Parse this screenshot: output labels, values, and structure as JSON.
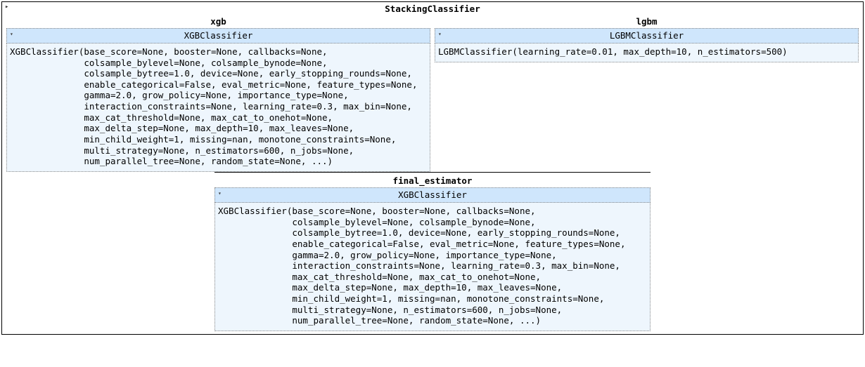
{
  "main": {
    "title": "StackingClassifier",
    "toggle_glyph": "▸"
  },
  "estimators": [
    {
      "name": "xgb",
      "header": "XGBClassifier",
      "toggle_glyph": "▾",
      "body": "XGBClassifier(base_score=None, booster=None, callbacks=None,\n              colsample_bylevel=None, colsample_bynode=None,\n              colsample_bytree=1.0, device=None, early_stopping_rounds=None,\n              enable_categorical=False, eval_metric=None, feature_types=None,\n              gamma=2.0, grow_policy=None, importance_type=None,\n              interaction_constraints=None, learning_rate=0.3, max_bin=None,\n              max_cat_threshold=None, max_cat_to_onehot=None,\n              max_delta_step=None, max_depth=10, max_leaves=None,\n              min_child_weight=1, missing=nan, monotone_constraints=None,\n              multi_strategy=None, n_estimators=600, n_jobs=None,\n              num_parallel_tree=None, random_state=None, ...)"
    },
    {
      "name": "lgbm",
      "header": "LGBMClassifier",
      "toggle_glyph": "▾",
      "body": "LGBMClassifier(learning_rate=0.01, max_depth=10, n_estimators=500)"
    }
  ],
  "final_estimator": {
    "title": "final_estimator",
    "header": "XGBClassifier",
    "toggle_glyph": "▾",
    "body": "XGBClassifier(base_score=None, booster=None, callbacks=None,\n              colsample_bylevel=None, colsample_bynode=None,\n              colsample_bytree=1.0, device=None, early_stopping_rounds=None,\n              enable_categorical=False, eval_metric=None, feature_types=None,\n              gamma=2.0, grow_policy=None, importance_type=None,\n              interaction_constraints=None, learning_rate=0.3, max_bin=None,\n              max_cat_threshold=None, max_cat_to_onehot=None,\n              max_delta_step=None, max_depth=10, max_leaves=None,\n              min_child_weight=1, missing=nan, monotone_constraints=None,\n              multi_strategy=None, n_estimators=600, n_jobs=None,\n              num_parallel_tree=None, random_state=None, ...)"
  }
}
